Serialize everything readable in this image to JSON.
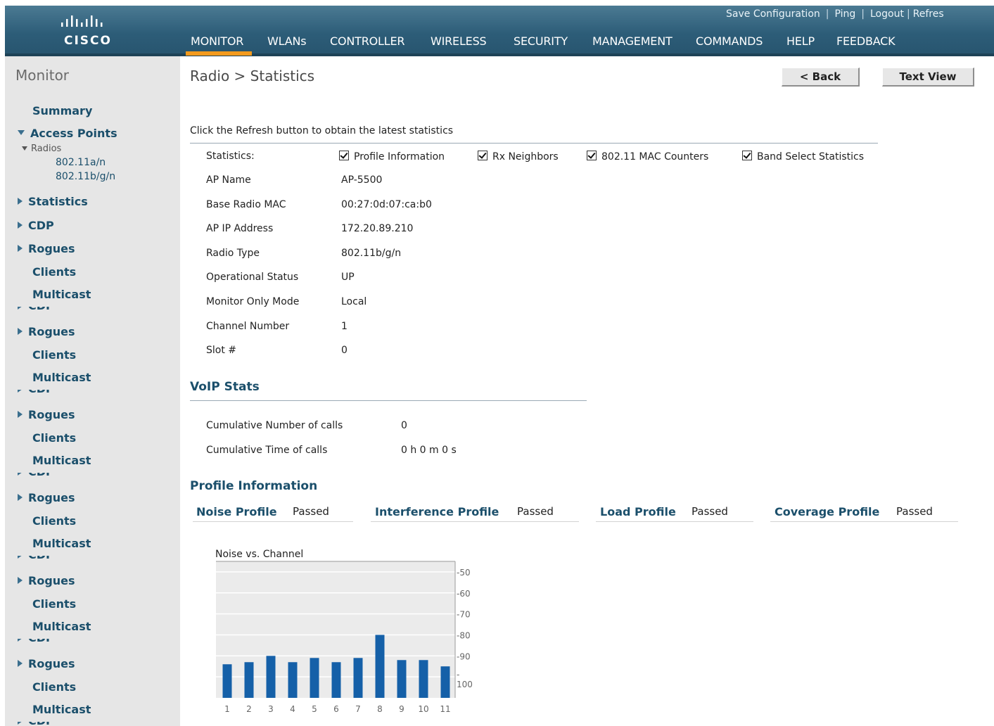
{
  "header": {
    "logo_text": "CISCO",
    "util_links": [
      "Save Configuration",
      "Ping",
      "Logout",
      "Refres"
    ],
    "menu": [
      "MONITOR",
      "WLANs",
      "CONTROLLER",
      "WIRELESS",
      "SECURITY",
      "MANAGEMENT",
      "COMMANDS",
      "HELP",
      "FEEDBACK"
    ],
    "active_menu": "MONITOR",
    "colors": {
      "bar": "#2d5d78",
      "active_underline": "#f39a1d"
    }
  },
  "sidebar": {
    "title": "Monitor",
    "summary": "Summary",
    "access_points": "Access Points",
    "radios": "Radios",
    "radio_a": "802.11a/n",
    "radio_bg": "802.11b/g/n",
    "statistics": "Statistics",
    "cdp": "CDP",
    "rogues": "Rogues",
    "clients": "Clients",
    "multicast": "Multicast",
    "cut_cdp": "CDP"
  },
  "page": {
    "title": "Radio > Statistics",
    "back_button": "< Back",
    "text_view_button": "Text View",
    "refresh_note": "Click the Refresh button to obtain the latest statistics"
  },
  "statistics": {
    "label": "Statistics:",
    "checkboxes": [
      {
        "label": "Profile Information",
        "checked": true
      },
      {
        "label": "Rx Neighbors",
        "checked": true
      },
      {
        "label": "802.11 MAC Counters",
        "checked": true
      },
      {
        "label": "Band Select Statistics",
        "checked": true
      }
    ]
  },
  "ap_info": [
    {
      "label": "AP Name",
      "value": "AP-5500"
    },
    {
      "label": "Base Radio MAC",
      "value": "00:27:0d:07:ca:b0"
    },
    {
      "label": "AP IP Address",
      "value": "172.20.89.210"
    },
    {
      "label": "Radio Type",
      "value": "802.11b/g/n"
    },
    {
      "label": "Operational Status",
      "value": "UP"
    },
    {
      "label": "Monitor Only Mode",
      "value": "Local"
    },
    {
      "label": "Channel Number",
      "value": "1"
    },
    {
      "label": "Slot #",
      "value": "0"
    }
  ],
  "voip": {
    "title": "VoIP Stats",
    "rows": [
      {
        "label": "Cumulative Number of calls",
        "value": "0"
      },
      {
        "label": "Cumulative Time of calls",
        "value": "0 h 0 m 0 s"
      }
    ]
  },
  "profile": {
    "title": "Profile Information",
    "items": [
      {
        "name": "Noise Profile",
        "status": "Passed"
      },
      {
        "name": "Interference Profile",
        "status": "Passed"
      },
      {
        "name": "Load Profile",
        "status": "Passed"
      },
      {
        "name": "Coverage Profile",
        "status": "Passed"
      }
    ]
  },
  "chart_data": {
    "type": "bar",
    "title": "Noise vs. Channel",
    "categories": [
      "1",
      "2",
      "3",
      "4",
      "5",
      "6",
      "7",
      "8",
      "9",
      "10",
      "11"
    ],
    "values": [
      -94,
      -93,
      -90,
      -93,
      -91,
      -93,
      -91,
      -80,
      -92,
      -92,
      -95
    ],
    "y_tick_labels": [
      "-50",
      "-60",
      "-70",
      "-80",
      "-90",
      "-\n100"
    ],
    "y_ticks": [
      -50,
      -60,
      -70,
      -80,
      -90,
      -100
    ],
    "ylim": [
      -110,
      -45
    ],
    "grid": true,
    "bar_color": "#1560a8"
  }
}
